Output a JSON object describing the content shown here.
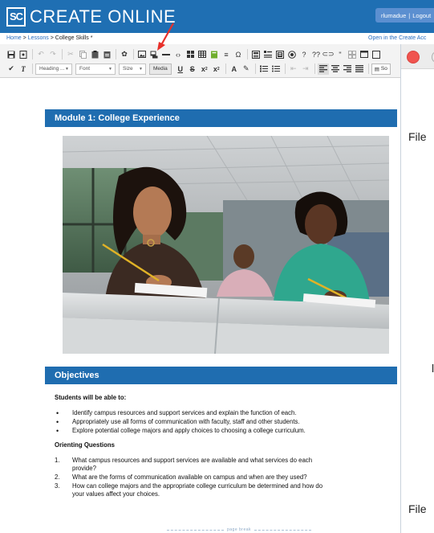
{
  "header": {
    "logo_mark": "SC",
    "app_title": "CREATE ONLINE",
    "user_name": "rlumadue",
    "logout_label": "Logout",
    "user_separator": "|"
  },
  "breadcrumb": {
    "home": "Home",
    "lessons": "Lessons",
    "current": "College Skills *",
    "separator": ">",
    "open_link": "Open in the Create Acc"
  },
  "toolbar": {
    "heading_combo": "Heading ...",
    "font_combo": "Font",
    "size_combo": "Size",
    "media_label": "Media",
    "source_label": "So",
    "annotation_arrow_color": "#e8302a"
  },
  "content": {
    "module_title": "Module 1: College Experience",
    "objectives_title": "Objectives",
    "students_heading": "Students will be able to:",
    "objectives": [
      "Identify campus resources and support services and explain the function of each.",
      "Appropriately use all forms of communication with faculty, staff and other students.",
      "Explore potential college majors and apply choices to choosing a college curriculum."
    ],
    "orienting_heading": "Orienting Questions",
    "questions": [
      {
        "num": "1.",
        "line1": "What campus resources and support services are available and what services do each",
        "line2": "provide?"
      },
      {
        "num": "2.",
        "line1": "What are the forms of communication available on campus and when are they used?",
        "line2": ""
      },
      {
        "num": "3.",
        "line1": "How can college majors and the appropriate college curriculum be determined and how do",
        "line2": "your values affect your choices."
      }
    ],
    "page_break": "page break",
    "section_color": "#1f6db0"
  },
  "right_panel": {
    "file_top": "File",
    "file_bottom": "File",
    "mid_letter": "l"
  }
}
